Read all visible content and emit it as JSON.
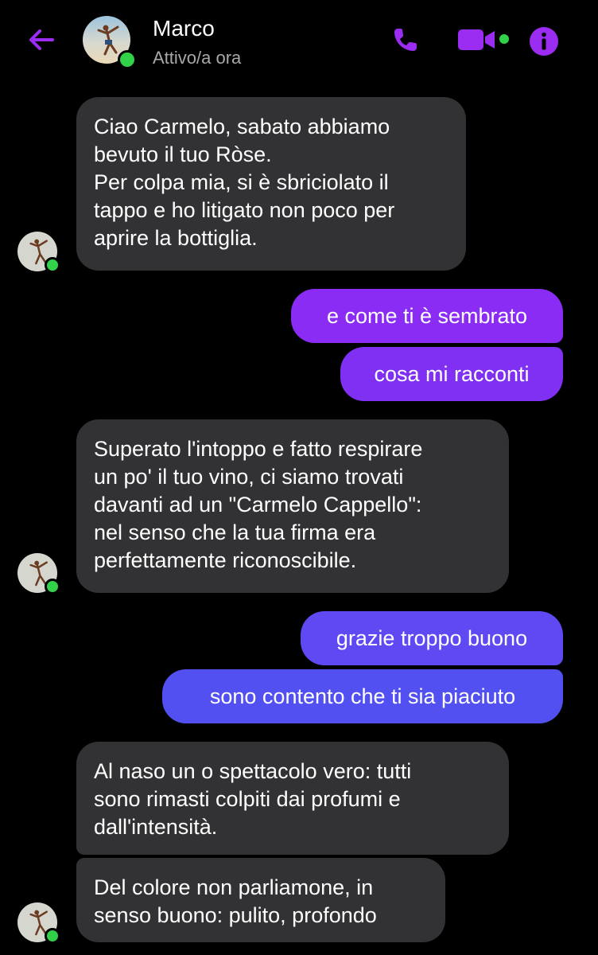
{
  "header": {
    "name": "Marco",
    "status": "Attivo/a ora"
  },
  "colors": {
    "accent": "#9b2cf2",
    "online": "#31d24a",
    "incoming_bubble": "#323234",
    "outgoing_purple": "#8b2cf5",
    "outgoing_blue": "#5a4cf2"
  },
  "icons": {
    "back": "back-arrow-icon",
    "call": "phone-icon",
    "video": "video-camera-icon",
    "info": "info-icon"
  },
  "messages": [
    {
      "direction": "in",
      "text": "Ciao Carmelo, sabato abbiamo\nbevuto il tuo Ròse.\nPer colpa mia, si è sbriciolato il\ntappo e ho litigato non poco per\naprire la bottiglia."
    },
    {
      "direction": "out",
      "text": "e come ti è sembrato"
    },
    {
      "direction": "out",
      "text": "cosa mi racconti"
    },
    {
      "direction": "in",
      "text": "Superato l'intoppo e fatto respirare\nun po' il tuo vino, ci siamo trovati\ndavanti ad un \"Carmelo Cappello\":\nnel senso che la tua firma era\nperfettamente riconoscibile."
    },
    {
      "direction": "out",
      "text": "grazie troppo buono"
    },
    {
      "direction": "out",
      "text": "sono contento che ti sia piaciuto"
    },
    {
      "direction": "in",
      "text": "Al naso un o spettacolo vero: tutti\nsono rimasti colpiti dai profumi e\ndall'intensità."
    },
    {
      "direction": "in",
      "text": "Del colore non parliamone, in\nsenso buono: pulito, profondo"
    }
  ]
}
